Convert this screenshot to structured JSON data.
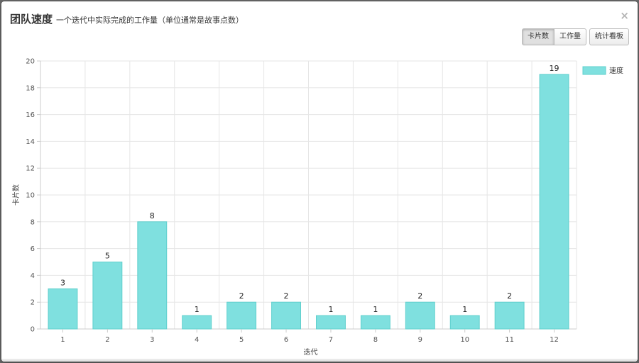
{
  "header": {
    "title": "团队速度",
    "subtitle": "一个迭代中实际完成的工作量（单位通常是故事点数）",
    "close_label": "×"
  },
  "toolbar": {
    "cards_label": "卡片数",
    "workload_label": "工作量",
    "board_label": "统计看板"
  },
  "chart_data": {
    "type": "bar",
    "categories": [
      "1",
      "2",
      "3",
      "4",
      "5",
      "6",
      "7",
      "8",
      "9",
      "10",
      "11",
      "12"
    ],
    "series": [
      {
        "name": "速度",
        "values": [
          3,
          5,
          8,
          1,
          2,
          2,
          1,
          1,
          2,
          1,
          2,
          19
        ],
        "color": "#7fe0df",
        "stroke": "#5fcfcd"
      }
    ],
    "xlabel": "迭代",
    "ylabel": "卡片数",
    "ylim": [
      0,
      20
    ],
    "yticks": [
      0,
      2,
      4,
      6,
      8,
      10,
      12,
      14,
      16,
      18,
      20
    ],
    "grid": true,
    "legend_position": "top-right"
  }
}
